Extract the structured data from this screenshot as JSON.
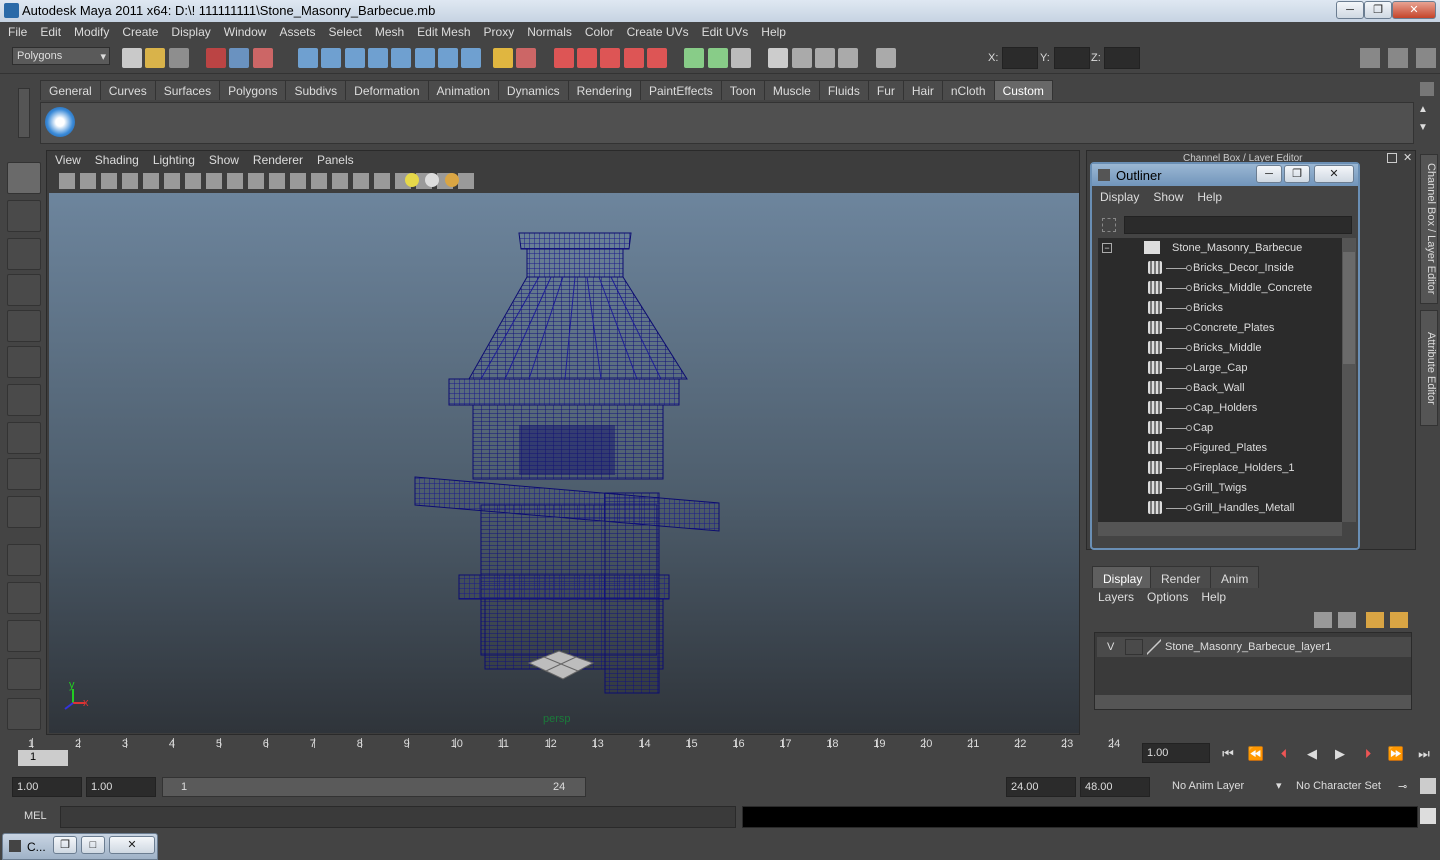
{
  "window": {
    "title": "Autodesk Maya 2011 x64: D:\\! 111111111\\Stone_Masonry_Barbecue.mb",
    "minimize": "─",
    "maximize": "❐",
    "close": "✕"
  },
  "menubar": [
    "File",
    "Edit",
    "Modify",
    "Create",
    "Display",
    "Window",
    "Assets",
    "Select",
    "Mesh",
    "Edit Mesh",
    "Proxy",
    "Normals",
    "Color",
    "Create UVs",
    "Edit UVs",
    "Help"
  ],
  "statusline": {
    "mode": "Polygons",
    "x_label": "X:",
    "y_label": "Y:",
    "z_label": "Z:"
  },
  "shelf": {
    "tabs": [
      "General",
      "Curves",
      "Surfaces",
      "Polygons",
      "Subdivs",
      "Deformation",
      "Animation",
      "Dynamics",
      "Rendering",
      "PaintEffects",
      "Toon",
      "Muscle",
      "Fluids",
      "Fur",
      "Hair",
      "nCloth",
      "Custom"
    ],
    "active_tab": "Custom"
  },
  "viewport": {
    "menu": [
      "View",
      "Shading",
      "Lighting",
      "Show",
      "Renderer",
      "Panels"
    ],
    "camera_label": "persp",
    "axis_x": "x",
    "axis_y": "y"
  },
  "channelbox": {
    "title": "Channel Box / Layer Editor"
  },
  "sidetabs": {
    "channel": "Channel Box / Layer Editor",
    "attribute": "Attribute Editor"
  },
  "outliner": {
    "title": "Outliner",
    "menu": [
      "Display",
      "Show",
      "Help"
    ],
    "root": "Stone_Masonry_Barbecue",
    "items": [
      "Bricks_Decor_Inside",
      "Bricks_Middle_Concrete",
      "Bricks",
      "Concrete_Plates",
      "Bricks_Middle",
      "Large_Cap",
      "Back_Wall",
      "Cap_Holders",
      "Cap",
      "Figured_Plates",
      "Fireplace_Holders_1",
      "Grill_Twigs",
      "Grill_Handles_Metall"
    ]
  },
  "layer_editor": {
    "tabs": [
      "Display",
      "Render",
      "Anim"
    ],
    "active_tab": "Display",
    "menu": [
      "Layers",
      "Options",
      "Help"
    ],
    "layer_visibility": "V",
    "layer_name": "Stone_Masonry_Barbecue_layer1"
  },
  "timeline": {
    "ticks": [
      "1",
      "2",
      "3",
      "4",
      "5",
      "6",
      "7",
      "8",
      "9",
      "10",
      "11",
      "12",
      "13",
      "14",
      "15",
      "16",
      "17",
      "18",
      "19",
      "20",
      "21",
      "22",
      "23",
      "24"
    ],
    "current_marker": "1",
    "current_frame": "1.00"
  },
  "range": {
    "start": "1.00",
    "playback_start": "1.00",
    "slider_start": "1",
    "slider_end": "24",
    "playback_end": "24.00",
    "end": "48.00",
    "anim_layer": "No Anim Layer",
    "character_set": "No Character Set"
  },
  "cmdline": {
    "label": "MEL"
  },
  "minimized": {
    "label": "C..."
  }
}
